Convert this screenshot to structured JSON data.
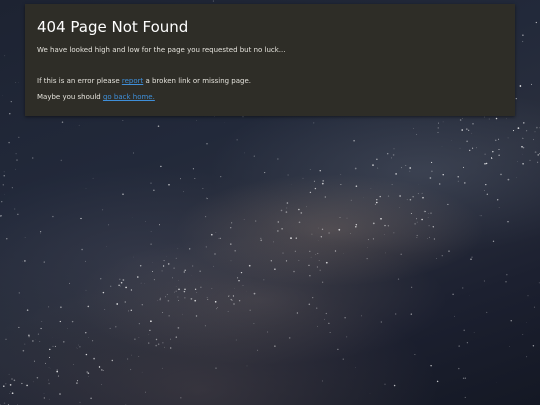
{
  "page": {
    "title": "404 Page Not Found",
    "message": "We have looked high and low for the page you requested but no luck...",
    "report_prefix": "If this is an error please ",
    "report_link": "report",
    "report_suffix": " a broken link or missing page.",
    "home_prefix": "Maybe you should ",
    "home_link": "go back home."
  },
  "colors": {
    "panel_bg": "#2e2d27",
    "link": "#3f8fd9"
  },
  "background": {
    "icon": "starry-night-sky-image"
  }
}
